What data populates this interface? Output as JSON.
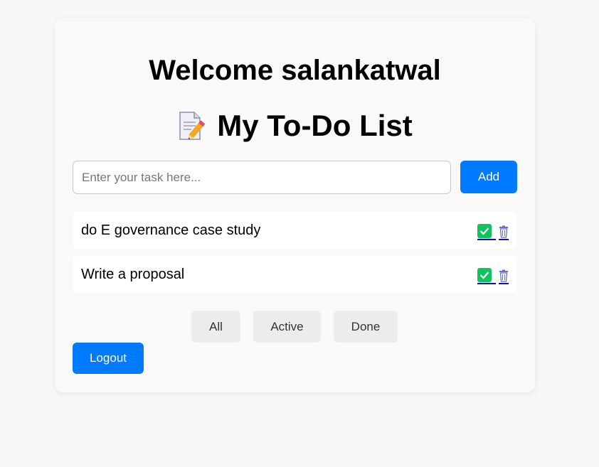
{
  "header": {
    "welcome": "Welcome salankatwal",
    "title": "My To-Do List",
    "title_icon": "memo-icon"
  },
  "input": {
    "placeholder": "Enter your task here...",
    "value": "",
    "add_label": "Add"
  },
  "tasks": [
    {
      "text": "do E governance case study",
      "done_icon": "check-icon",
      "delete_icon": "trash-icon"
    },
    {
      "text": "Write a proposal",
      "done_icon": "check-icon",
      "delete_icon": "trash-icon"
    }
  ],
  "filters": [
    "All",
    "Active",
    "Done"
  ],
  "logout_label": "Logout",
  "colors": {
    "primary": "#007bff",
    "check": "#10c45c",
    "filter_bg": "#ececec",
    "page_bg": "#f8f8f8"
  }
}
